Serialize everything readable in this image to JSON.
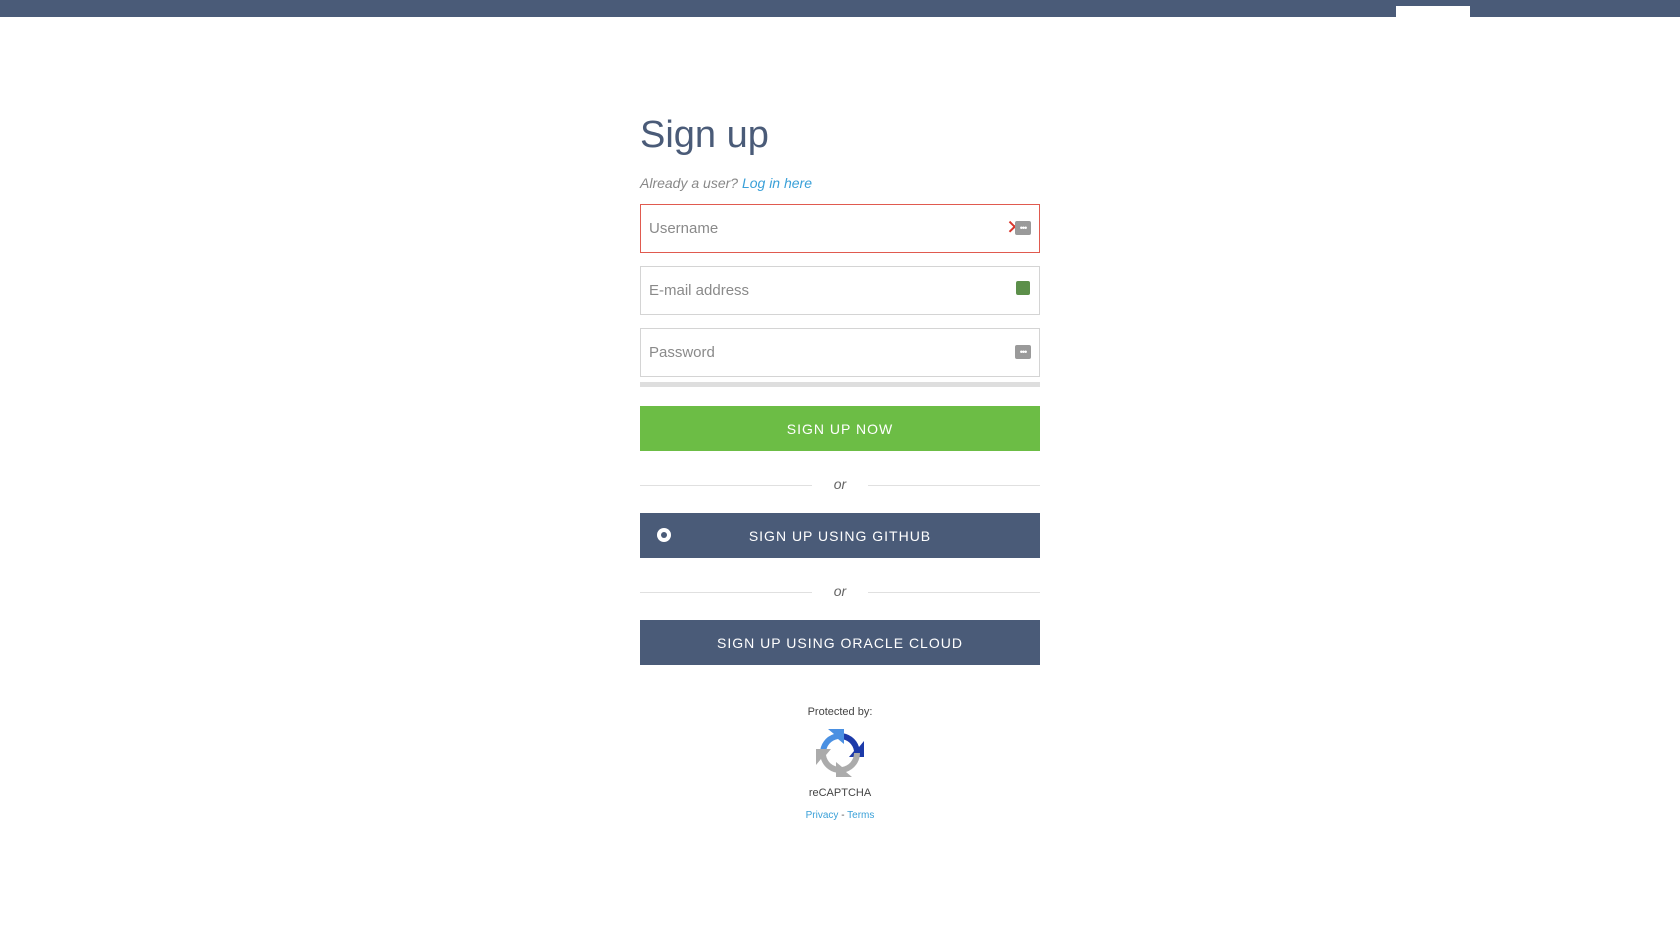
{
  "page": {
    "title": "Sign up",
    "already_user_text": "Already a user?",
    "login_link_label": "Log in here"
  },
  "form": {
    "username_placeholder": "Username",
    "username_value": "",
    "email_placeholder": "E-mail address",
    "email_value": "",
    "password_placeholder": "Password",
    "password_value": "",
    "username_error_mark": "✕",
    "field_icon_glyph": "•••"
  },
  "buttons": {
    "signup_now": "SIGN UP NOW",
    "signup_github": "SIGN UP USING GITHUB",
    "signup_oracle": "SIGN UP USING ORACLE CLOUD"
  },
  "dividers": {
    "or_1": "or",
    "or_2": "or"
  },
  "recaptcha": {
    "protected_by": "Protected by:",
    "label": "reCAPTCHA",
    "privacy": "Privacy",
    "separator": " - ",
    "terms": "Terms"
  },
  "colors": {
    "brand_dark": "#4a5b78",
    "brand_green": "#6cbd45",
    "link_blue": "#3aa0d8",
    "error_red": "#e05a4f"
  },
  "icons": {
    "username_field": "password-manager-icon",
    "email_field": "contact-card-icon",
    "password_field": "password-manager-icon",
    "github_button": "github-icon",
    "recaptcha": "recaptcha-logo"
  }
}
